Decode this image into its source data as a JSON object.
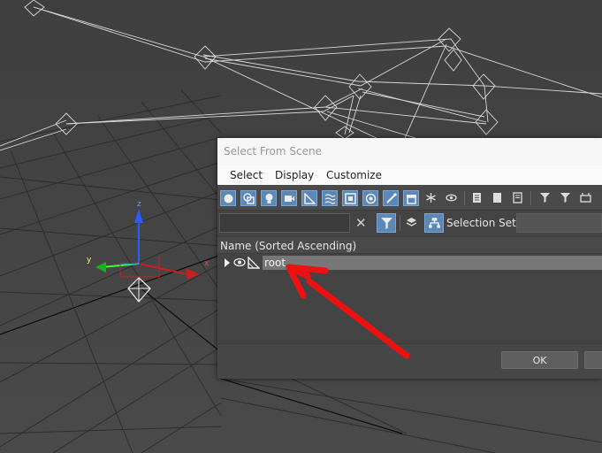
{
  "dialog": {
    "title": "Select From Scene",
    "menu": [
      "Select",
      "Display",
      "Customize"
    ],
    "filter": {
      "search_value": "",
      "selection_set_label": "Selection Set:",
      "selection_set_value": ""
    },
    "column_header": "Name (Sorted Ascending)",
    "tree": [
      {
        "label": "root",
        "expanded": false,
        "visible": true,
        "type": "bone",
        "selected": true
      }
    ],
    "buttons": {
      "ok": "OK",
      "cancel": ""
    }
  },
  "toolbar_icons": [
    "geometry-filter-icon",
    "shapes-filter-icon",
    "lights-filter-icon",
    "cameras-filter-icon",
    "helpers-filter-icon",
    "spacewarps-filter-icon",
    "groups-filter-icon",
    "xrefs-filter-icon",
    "bones-filter-icon",
    "containers-filter-icon",
    "frozen-filter-icon",
    "hidden-filter-icon",
    "display-all-icon",
    "display-none-icon",
    "invert-display-icon",
    "find-selected-icon",
    "filter-funnel-icon",
    "dock-icon"
  ],
  "viewport": {
    "gizmo_axes": {
      "x": "x",
      "y": "y",
      "z": "z"
    }
  },
  "colors": {
    "accent": "#5c88b8",
    "annotation_arrow": "#ee1111",
    "selection_row": "#777777"
  }
}
